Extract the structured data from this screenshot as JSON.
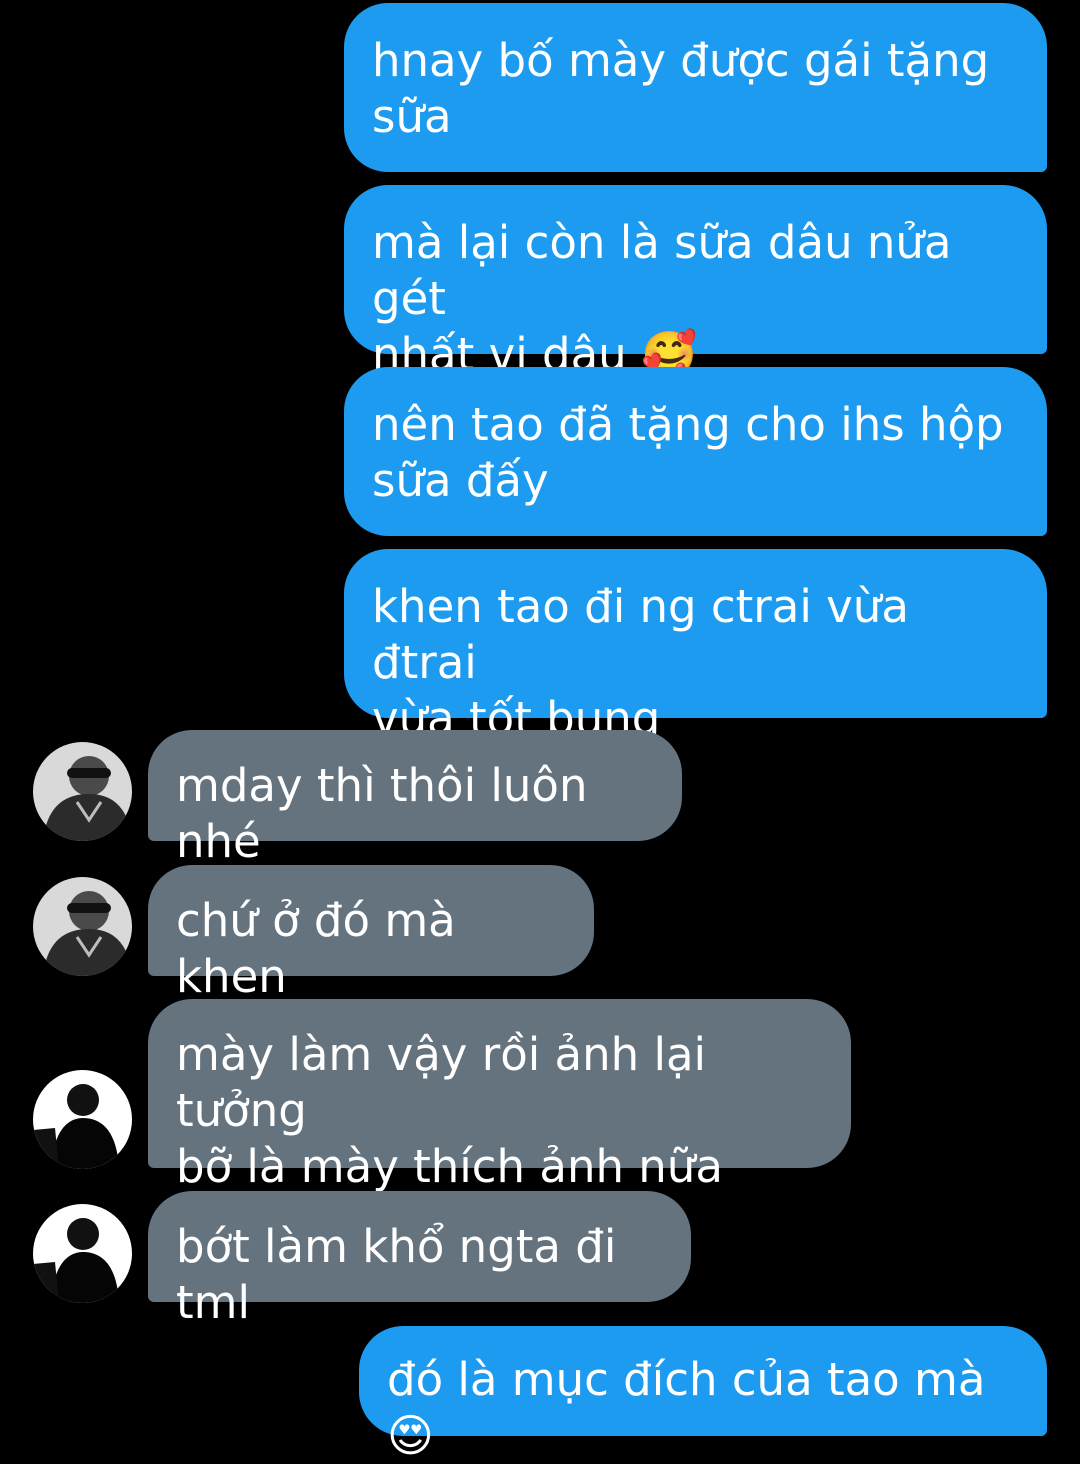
{
  "colors": {
    "background": "#000000",
    "sent_bubble": "#1d9bf0",
    "received_bubble": "#65737f",
    "text": "#ffffff"
  },
  "messages": [
    {
      "direction": "sent",
      "text": "hnay bố mày được gái tặng\nsữa"
    },
    {
      "direction": "sent",
      "text": "mà lại còn là sữa dâu nửa gét\nnhất vị dâu 🥰"
    },
    {
      "direction": "sent",
      "text": "nên tao đã tặng cho ihs hộp\nsữa đấy"
    },
    {
      "direction": "sent",
      "text": "khen tao đi ng ctrai vừa đtrai\nvừa tốt bụng"
    },
    {
      "direction": "received",
      "text": "mday thì thôi luôn nhé",
      "avatar": "avatar-sunglasses"
    },
    {
      "direction": "received",
      "text": "chứ ở đó mà khen",
      "avatar": "avatar-sunglasses"
    },
    {
      "direction": "received",
      "text": "mày làm vậy rồi ảnh lại tưởng\nbỡ là mày thích ảnh nữa",
      "avatar": "avatar-black-white"
    },
    {
      "direction": "received",
      "text": "bớt làm khổ ngta đi tml",
      "avatar": "avatar-black-white"
    },
    {
      "direction": "sent",
      "text": "đó là mục đích của tao mà 😍"
    }
  ]
}
